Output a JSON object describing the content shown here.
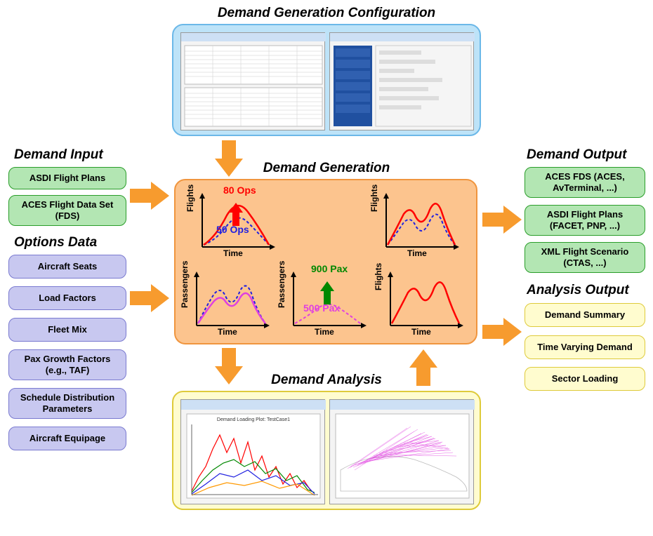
{
  "titles": {
    "config": "Demand Generation Configuration",
    "input": "Demand Input",
    "options": "Options Data",
    "generation": "Demand Generation",
    "analysis": "Demand Analysis",
    "output": "Demand Output",
    "analysisOutput": "Analysis Output"
  },
  "demandInput": [
    "ASDI Flight Plans",
    "ACES Flight Data Set (FDS)"
  ],
  "optionsData": [
    "Aircraft Seats",
    "Load Factors",
    "Fleet Mix",
    "Pax Growth Factors (e.g., TAF)",
    "Schedule Distribution Parameters",
    "Aircraft Equipage"
  ],
  "demandOutput": [
    "ACES FDS (ACES, AvTerminal, ...)",
    "ASDI Flight Plans (FACET, PNP, ...)",
    "XML Flight Scenario (CTAS, ...)"
  ],
  "analysisOutput": [
    "Demand Summary",
    "Time Varying Demand",
    "Sector Loading"
  ],
  "chartLabels": {
    "flights": "Flights",
    "passengers": "Passengers",
    "time": "Time",
    "ops80": "80 Ops",
    "ops50": "50 Ops",
    "pax900": "900 Pax",
    "pax500": "500 Pax"
  },
  "colors": {
    "arrowOrange": "#f79b2e",
    "red": "#ff0000",
    "blue": "#2020e0",
    "green": "#008800",
    "magenta": "#e040e0"
  }
}
